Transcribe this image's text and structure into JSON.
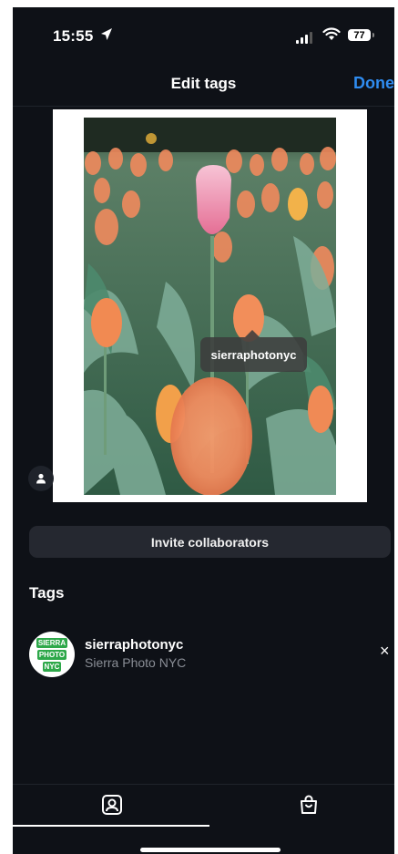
{
  "status_bar": {
    "time": "15:55",
    "battery": "77"
  },
  "header": {
    "title": "Edit tags",
    "done_label": "Done"
  },
  "photo": {
    "tag_label": "sierraphotonyc"
  },
  "invite": {
    "label": "Invite collaborators"
  },
  "tags": {
    "heading": "Tags",
    "items": [
      {
        "username": "sierraphotonyc",
        "full_name": "Sierra Photo NYC",
        "avatar_text": [
          "SIERRA",
          "PHOTO",
          "NYC"
        ],
        "remove_label": "×"
      }
    ]
  },
  "tabs": [
    {
      "name": "tag-people",
      "icon": "person-tag-icon",
      "active": true
    },
    {
      "name": "tag-products",
      "icon": "shopping-bag-icon",
      "active": false
    }
  ],
  "colors": {
    "accent": "#2f8cf0",
    "background": "#0e1117",
    "avatar_green": "#2ea84a"
  }
}
